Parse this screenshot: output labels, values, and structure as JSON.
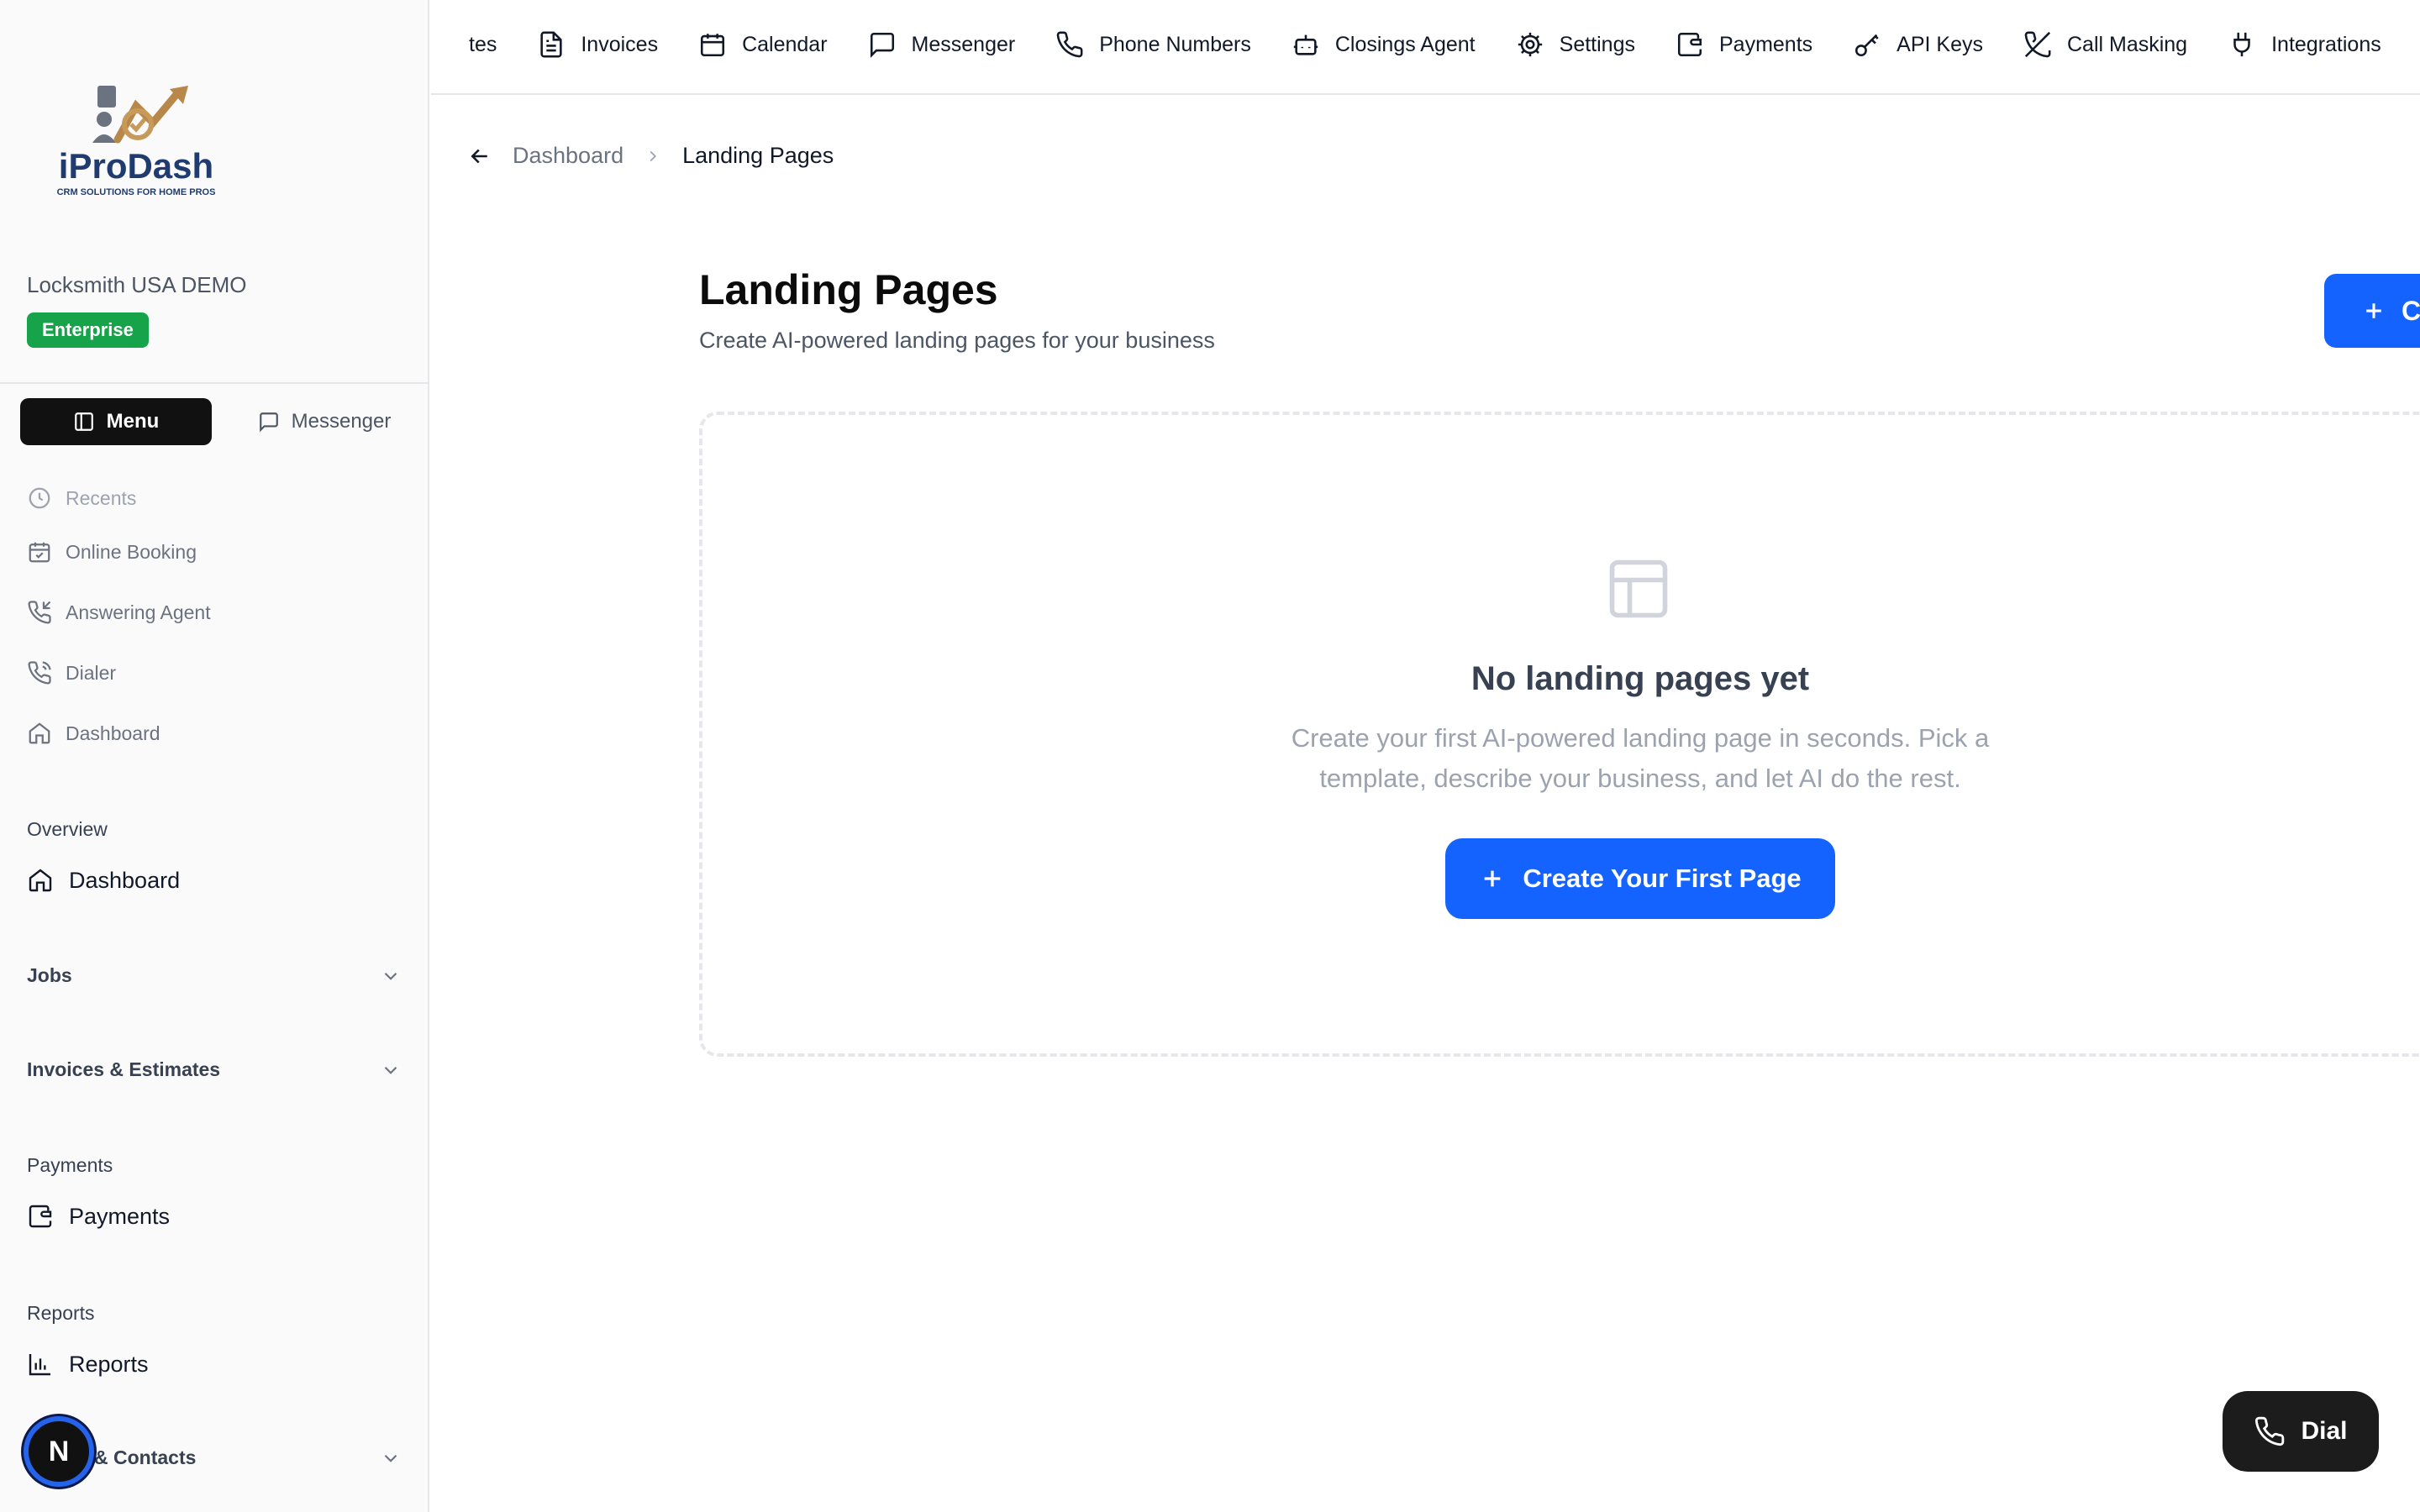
{
  "sidebar": {
    "logo_text": "iProDash",
    "logo_tagline": "CRM SOLUTIONS FOR HOME PROS",
    "org_name": "Locksmith USA DEMO",
    "plan_badge": "Enterprise",
    "toggle": {
      "menu_label": "Menu",
      "messenger_label": "Messenger"
    },
    "quick_links": [
      {
        "label": "Recents",
        "icon": "clock-icon"
      },
      {
        "label": "Online Booking",
        "icon": "calendar-check-icon"
      },
      {
        "label": "Answering Agent",
        "icon": "phone-incoming-icon"
      },
      {
        "label": "Dialer",
        "icon": "phone-call-icon"
      },
      {
        "label": "Dashboard",
        "icon": "home-icon"
      }
    ],
    "sections": {
      "overview": {
        "title": "Overview",
        "item": "Dashboard"
      },
      "jobs": {
        "title": "Jobs"
      },
      "invoices": {
        "title": "Invoices & Estimates"
      },
      "payments": {
        "title": "Payments",
        "item": "Payments"
      },
      "reports": {
        "title": "Reports",
        "item": "Reports"
      },
      "contacts": {
        "title": "& Contacts"
      }
    },
    "avatar_initial": "N"
  },
  "topnav": {
    "items": [
      {
        "label": "tes",
        "icon": ""
      },
      {
        "label": "Invoices",
        "icon": "file-text-icon"
      },
      {
        "label": "Calendar",
        "icon": "calendar-icon"
      },
      {
        "label": "Messenger",
        "icon": "message-square-icon"
      },
      {
        "label": "Phone Numbers",
        "icon": "phone-icon"
      },
      {
        "label": "Closings Agent",
        "icon": "bot-icon"
      },
      {
        "label": "Settings",
        "icon": "gear-icon"
      },
      {
        "label": "Payments",
        "icon": "wallet-icon"
      },
      {
        "label": "API Keys",
        "icon": "key-icon"
      },
      {
        "label": "Call Masking",
        "icon": "phone-off-icon"
      },
      {
        "label": "Integrations",
        "icon": "plug-icon"
      }
    ]
  },
  "breadcrumb": {
    "parent": "Dashboard",
    "current": "Landing Pages"
  },
  "main": {
    "title": "Landing Pages",
    "subtitle": "Create AI-powered landing pages for your business",
    "create_button_label": "C",
    "empty_state": {
      "title": "No landing pages yet",
      "description": "Create your first AI-powered landing page in seconds. Pick a template, describe your business, and let AI do the rest.",
      "button_label": "Create Your First Page"
    }
  },
  "dial_button_label": "Dial",
  "colors": {
    "primary": "#1463ff",
    "badge": "#16a34a",
    "dark": "#111111"
  }
}
